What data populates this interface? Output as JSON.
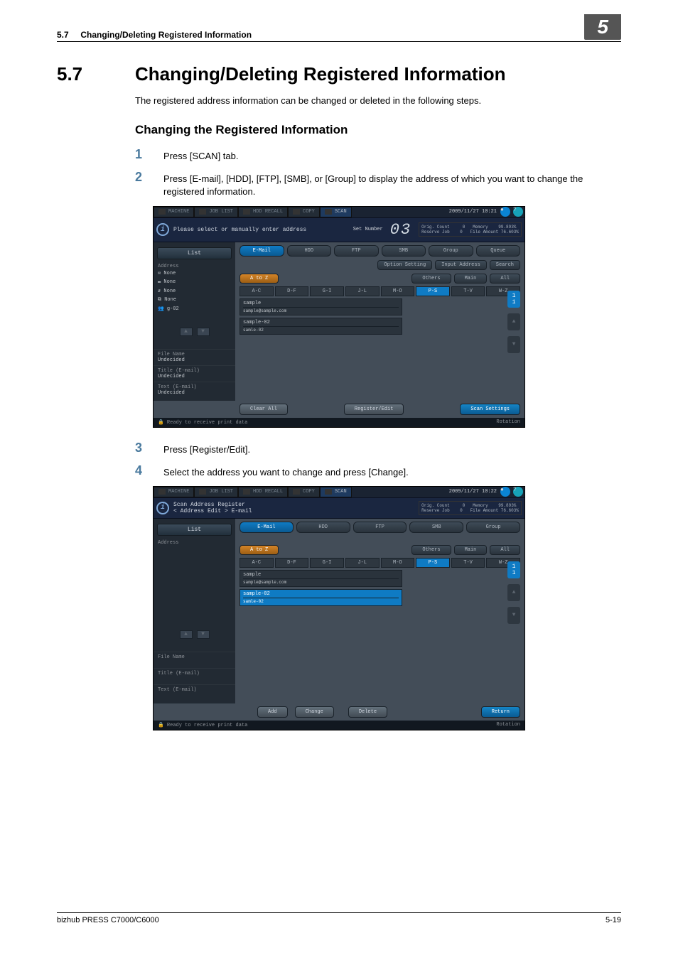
{
  "header": {
    "section_ref": "5.7",
    "title_short": "Changing/Deleting Registered Information",
    "chapter": "5"
  },
  "main": {
    "section_num": "5.7",
    "section_title": "Changing/Deleting Registered Information",
    "intro": "The registered address information can be changed or deleted in the following steps.",
    "subheading": "Changing the Registered Information",
    "steps": [
      {
        "num": "1",
        "text": "Press [SCAN] tab."
      },
      {
        "num": "2",
        "text": "Press [E-mail], [HDD], [FTP], [SMB], or [Group] to display the address of which you want to change the registered information."
      },
      {
        "num": "3",
        "text": "Press [Register/Edit]."
      },
      {
        "num": "4",
        "text": "Select the address you want to change and press [Change]."
      }
    ]
  },
  "screen1": {
    "top_tabs": [
      "MACHINE",
      "JOB LIST",
      "HDD RECALL",
      "COPY",
      "SCAN"
    ],
    "datetime": "2009/11/27 10:21",
    "info_text": "Please select or manually enter address",
    "set_number_label": "Set Number",
    "set_number_value": "03",
    "stats": {
      "orig_count_label": "Orig. Count",
      "orig_count_val": "0",
      "reserve_label": "Reserve Job",
      "reserve_val": "0",
      "memory_label": "Memory",
      "memory_val": "99.893%",
      "file_label": "File Amount",
      "file_val": "76.603%"
    },
    "left": {
      "list_btn": "List",
      "address_label": "Address",
      "items": [
        "None",
        "None",
        "None",
        "None",
        "g-02"
      ],
      "fields": [
        {
          "label": "File Name",
          "value": "Undecided"
        },
        {
          "label": "Title (E-mail)",
          "value": "Undecided"
        },
        {
          "label": "Text (E-mail)",
          "value": "Undecided"
        }
      ]
    },
    "right": {
      "tabs": [
        "E-Mail",
        "HDD",
        "FTP",
        "SMB",
        "Group",
        "Queue"
      ],
      "row_buttons": [
        "Option Setting",
        "Input Address",
        "Search"
      ],
      "filter": [
        "A to Z",
        "Others",
        "Main",
        "All"
      ],
      "alpha": [
        "A-C",
        "D-F",
        "G-I",
        "J-L",
        "M-O",
        "P-S",
        "T-V",
        "W-Z"
      ],
      "alpha_selected": "P-S",
      "entries": [
        {
          "name": "sample",
          "detail": "sample@sample.com"
        },
        {
          "name": "sample-02",
          "detail": "samle-02"
        }
      ]
    },
    "bottom": {
      "clear_all": "Clear All",
      "register_edit": "Register/Edit",
      "scan_settings": "Scan Settings"
    },
    "status": {
      "left": "Ready to receive print data",
      "right": "Rotation"
    }
  },
  "screen2": {
    "top_tabs": [
      "MACHINE",
      "JOB LIST",
      "HDD RECALL",
      "COPY",
      "SCAN"
    ],
    "datetime": "2009/11/27 10:22",
    "info_line1": "Scan Address Register",
    "info_line2": "< Address Edit > E-mail",
    "stats": {
      "orig_count_label": "Orig. Count",
      "orig_count_val": "0",
      "reserve_label": "Reserve Job",
      "reserve_val": "0",
      "memory_label": "Memory",
      "memory_val": "99.893%",
      "file_label": "File Amount",
      "file_val": "76.603%"
    },
    "left": {
      "list_btn": "List",
      "address_label": "Address",
      "fields": [
        {
          "label": "File Name",
          "value": ""
        },
        {
          "label": "Title (E-mail)",
          "value": ""
        },
        {
          "label": "Text (E-mail)",
          "value": ""
        }
      ]
    },
    "right": {
      "tabs": [
        "E-Mail",
        "HDD",
        "FTP",
        "SMB",
        "Group"
      ],
      "filter": [
        "A to Z",
        "Others",
        "Main",
        "All"
      ],
      "alpha": [
        "A-C",
        "D-F",
        "G-I",
        "J-L",
        "M-O",
        "P-S",
        "T-V",
        "W-Z"
      ],
      "alpha_selected": "P-S",
      "entries": [
        {
          "name": "sample",
          "detail": "sample@sample.com"
        },
        {
          "name": "sample-02",
          "detail": "samle-02"
        }
      ],
      "selected_entry": "sample-02"
    },
    "bottom": {
      "add": "Add",
      "change": "Change",
      "delete": "Delete",
      "return": "Return"
    },
    "status": {
      "left": "Ready to receive print data",
      "right": "Rotation"
    }
  },
  "footer": {
    "product": "bizhub PRESS C7000/C6000",
    "page": "5-19"
  }
}
